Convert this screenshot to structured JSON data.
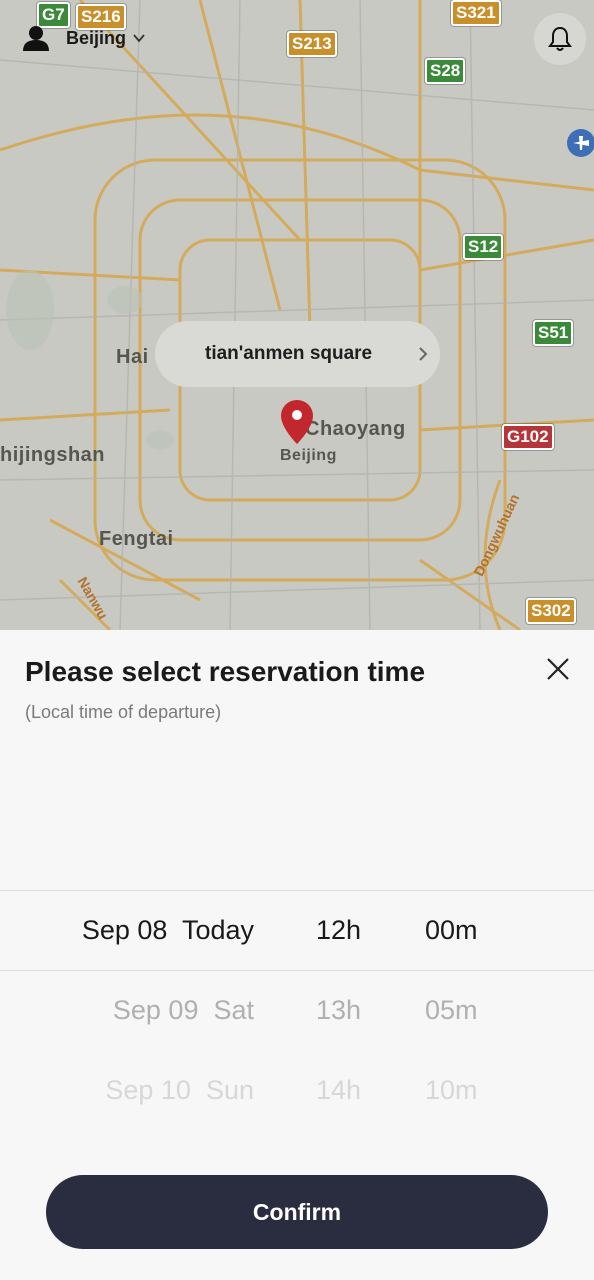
{
  "header": {
    "city": "Beijing"
  },
  "map": {
    "destination": "tian'anmen square",
    "shields": [
      "G7",
      "S216",
      "S213",
      "S321",
      "S28",
      "S12",
      "S51",
      "G102",
      "S302"
    ],
    "places": [
      "Hai",
      "Chaoyang",
      "Beijing",
      "hijingshan",
      "Fengtai"
    ],
    "roads": [
      "Nanwu",
      "Dongwuhuan"
    ]
  },
  "sheet": {
    "title": "Please select reservation time",
    "subtitle": "(Local time of departure)",
    "rows": [
      {
        "date": "Sep 08  Today",
        "hour": "12h",
        "minute": "00m"
      },
      {
        "date": "Sep 09  Sat",
        "hour": "13h",
        "minute": "05m"
      },
      {
        "date": "Sep 10  Sun",
        "hour": "14h",
        "minute": "10m"
      }
    ],
    "confirm_label": "Confirm"
  },
  "colors": {
    "map_bg": "#c9c9c4",
    "sheet_bg": "#f7f7f7",
    "button_bg": "#2a2d40",
    "pin": "#c3272e",
    "road": "#d7a64a"
  },
  "icons": [
    "user-icon",
    "chevron-down-icon",
    "bell-icon",
    "chevron-right-icon",
    "map-pin-icon",
    "airport-icon",
    "close-icon"
  ]
}
